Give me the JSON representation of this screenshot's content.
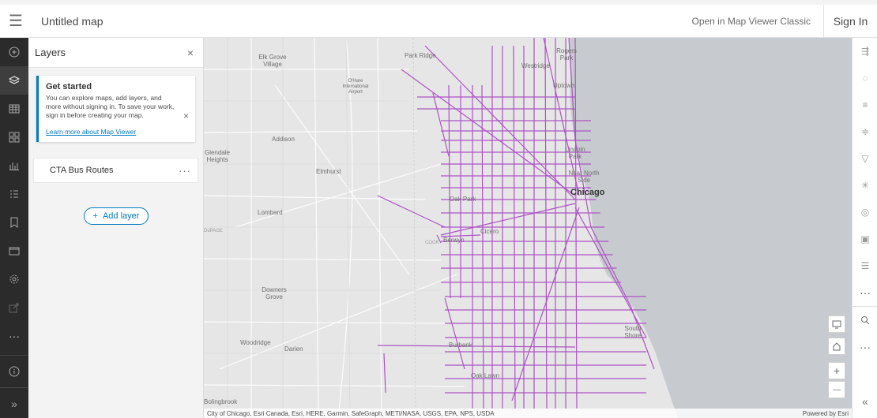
{
  "header": {
    "title": "Untitled map",
    "classic_link": "Open in Map Viewer Classic",
    "sign_in": "Sign In"
  },
  "left_bar": {
    "items": [
      {
        "icon": "add-icon",
        "active": false
      },
      {
        "icon": "layers-icon",
        "active": true
      },
      {
        "icon": "table-icon",
        "active": false
      },
      {
        "icon": "basemap-icon",
        "active": false
      },
      {
        "icon": "charts-icon",
        "active": false
      },
      {
        "icon": "legend-icon",
        "active": false
      },
      {
        "icon": "bookmark-icon",
        "active": false
      },
      {
        "icon": "map-properties-icon",
        "active": false
      },
      {
        "icon": "settings-icon",
        "active": false
      },
      {
        "icon": "share-icon",
        "active": false
      },
      {
        "icon": "more-icon",
        "active": false
      }
    ],
    "more_label": "···",
    "expand_label": "»"
  },
  "panel": {
    "title": "Layers",
    "close": "×",
    "notice": {
      "title": "Get started",
      "body": "You can explore maps, add layers, and more without signing in. To save your work, sign in before creating your map.",
      "link": "Learn more about Map Viewer",
      "close": "×"
    },
    "layers": [
      {
        "name": "CTA Bus Routes",
        "menu": "···"
      }
    ],
    "add_layer_label": "Add layer",
    "add_layer_plus": "+"
  },
  "map": {
    "places": [
      "Elk Grove Village",
      "Park Ridge",
      "Rogers Park",
      "Westridge",
      "O'Hare International Airport",
      "Uptown",
      "Addison",
      "Glendale Heights",
      "Elmhurst",
      "Lincoln Park",
      "Near North Side",
      "Chicago",
      "Oak Park",
      "Lombard",
      "DuPAGE",
      "Cicero",
      "Berwyn",
      "COOK",
      "Downers Grove",
      "South Shore",
      "Woodridge",
      "Darien",
      "Burbank",
      "Oak Lawn",
      "Bolingbrook"
    ],
    "attribution": "City of Chicago, Esri Canada, Esri, HERE, Garmin, SafeGraph, METI/NASA, USGS, EPA, NPS, USDA",
    "powered_by": "Powered by Esri",
    "route_color": "#a94cc3",
    "water_color": "#c7cbcf",
    "zoom_in": "+",
    "zoom_out": "—"
  },
  "right_bar": {
    "items": [
      "properties-icon",
      "styles-icon",
      "filter-fx-icon",
      "effects-icon",
      "filter-icon",
      "clustering-icon",
      "pop-ups-icon",
      "fields-icon",
      "labels-icon"
    ],
    "more_label": "···",
    "collapse_label": "«"
  },
  "colors": {
    "accent": "#007ac2",
    "dark_bar": "#2b2b2b"
  }
}
